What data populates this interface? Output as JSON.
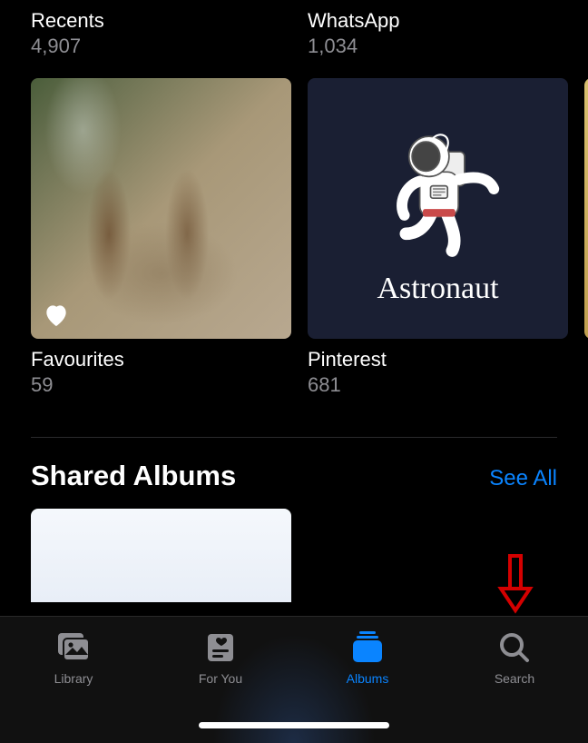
{
  "albums_row_top": [
    {
      "title": "Recents",
      "count": "4,907"
    },
    {
      "title": "WhatsApp",
      "count": "1,034"
    }
  ],
  "albums_row_mid": [
    {
      "title": "Favourites",
      "count": "59",
      "thumb_label": ""
    },
    {
      "title": "Pinterest",
      "count": "681",
      "thumb_label": "Astronaut"
    }
  ],
  "shared_section": {
    "title": "Shared Albums",
    "see_all": "See All"
  },
  "tabbar": {
    "items": [
      {
        "label": "Library",
        "active": false
      },
      {
        "label": "For You",
        "active": false
      },
      {
        "label": "Albums",
        "active": true
      },
      {
        "label": "Search",
        "active": false
      }
    ]
  },
  "colors": {
    "accent": "#0a84ff",
    "secondary_text": "#8e8e93"
  }
}
